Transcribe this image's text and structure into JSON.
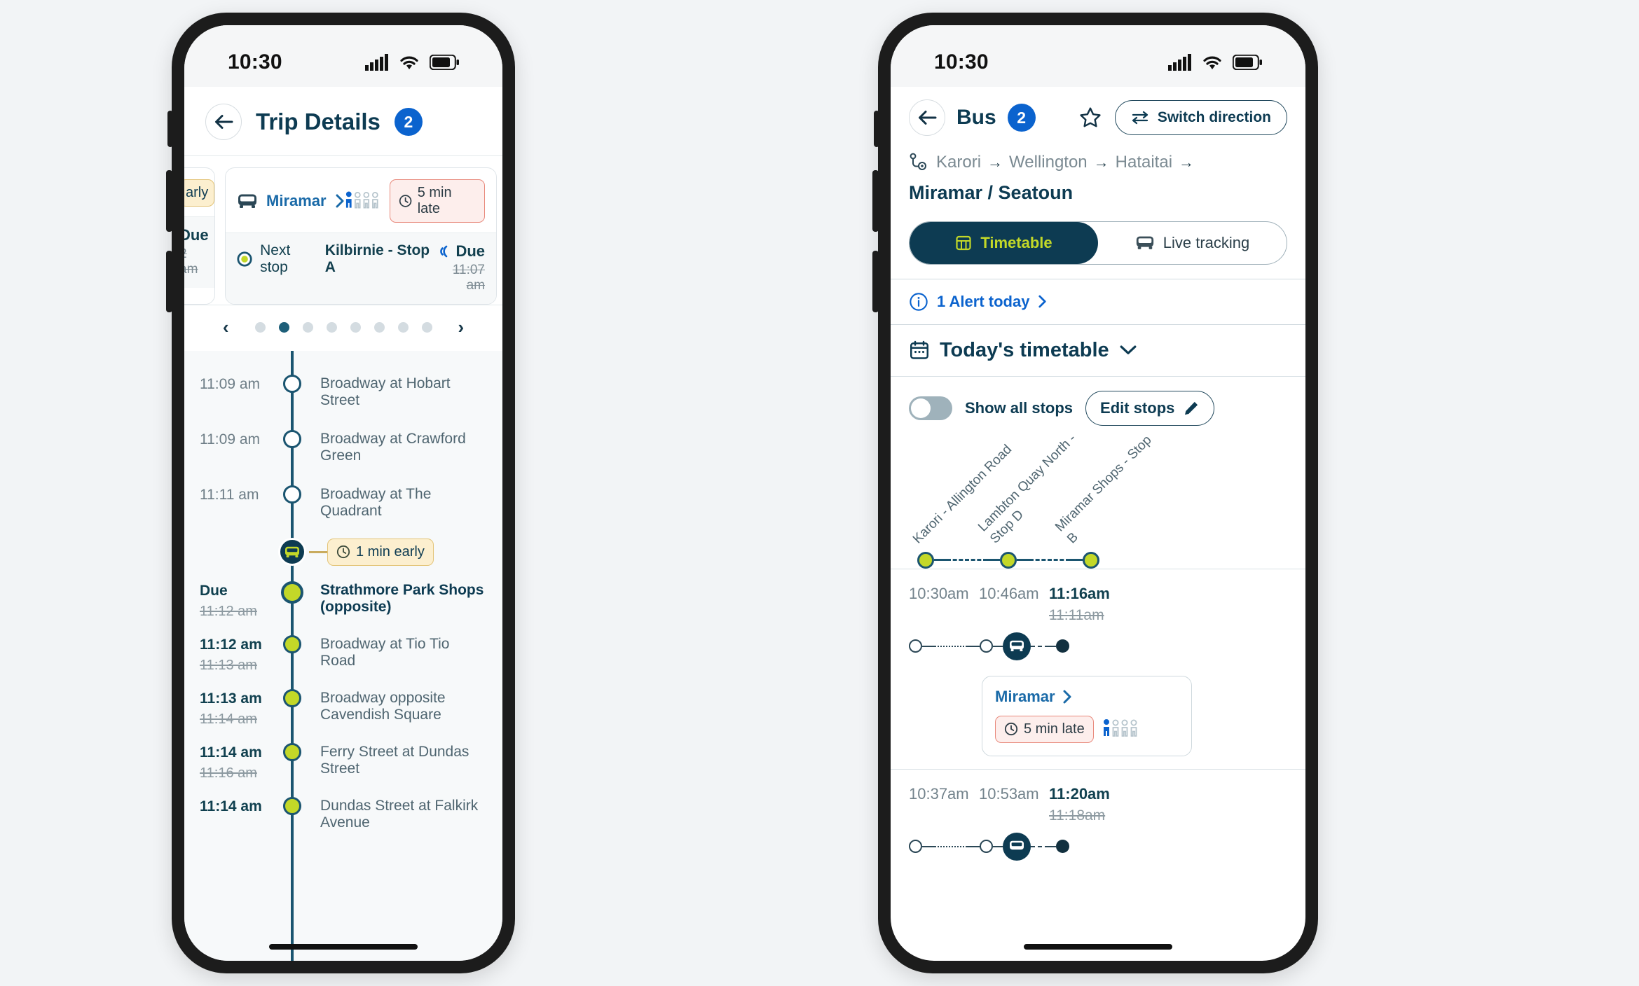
{
  "left_phone": {
    "status_bar": {
      "time": "10:30",
      "signal_icon": "cellular-signal-icon",
      "wifi_icon": "wifi-icon",
      "battery_icon": "battery-icon"
    },
    "header": {
      "back_icon": "back-arrow-icon",
      "title": "Trip Details",
      "badge": "2"
    },
    "partial_card": {
      "pill": "arly",
      "due_label": "Due",
      "due_strike": "2 am"
    },
    "trip_card": {
      "bus_icon": "bus-icon",
      "route_name": "Miramar",
      "chevron_icon": "chevron-right-icon",
      "occupancy_icon": "occupancy-people-icon",
      "status_icon": "clock-icon",
      "status_label": "5 min late",
      "next_stop_prefix": "Next stop",
      "next_stop_name": "Kilbirnie - Stop A",
      "realtime_icon": "live-signal-icon",
      "due_label": "Due",
      "due_strike": "11:07 am"
    },
    "pagination": {
      "prev_icon": "chevron-left-icon",
      "next_icon": "chevron-right-icon",
      "total": 8,
      "active_index": 1
    },
    "timeline": {
      "bus_marker": {
        "icon": "bus-icon",
        "status_icon": "clock-icon",
        "status_label": "1 min early"
      },
      "stops": [
        {
          "time": "11:09 am",
          "scheduled": "",
          "name": "Broadway at Hobart Street",
          "state": "past",
          "emphasis": false
        },
        {
          "time": "11:09 am",
          "scheduled": "",
          "name": "Broadway at Crawford Green",
          "state": "past",
          "emphasis": false
        },
        {
          "time": "11:11 am",
          "scheduled": "",
          "name": "Broadway at The Quadrant",
          "state": "past",
          "emphasis": false
        },
        {
          "time": "Due",
          "scheduled": "11:12 am",
          "name": "Strathmore Park Shops (opposite)",
          "state": "current",
          "emphasis": true
        },
        {
          "time": "11:12 am",
          "scheduled": "11:13 am",
          "name": "Broadway at Tio Tio Road",
          "state": "upcoming",
          "emphasis": false
        },
        {
          "time": "11:13 am",
          "scheduled": "11:14 am",
          "name": "Broadway opposite Cavendish Square",
          "state": "upcoming",
          "emphasis": false
        },
        {
          "time": "11:14 am",
          "scheduled": "11:16 am",
          "name": "Ferry Street at Dundas Street",
          "state": "upcoming",
          "emphasis": false
        },
        {
          "time": "11:14 am",
          "scheduled": "",
          "name": "Dundas Street at Falkirk Avenue",
          "state": "upcoming",
          "emphasis": false
        }
      ]
    }
  },
  "right_phone": {
    "status_bar": {
      "time": "10:30",
      "signal_icon": "cellular-signal-icon",
      "wifi_icon": "wifi-icon",
      "battery_icon": "battery-icon"
    },
    "header": {
      "back_icon": "back-arrow-icon",
      "mode_label": "Bus",
      "badge": "2",
      "favourite_icon": "star-outline-icon",
      "switch_icon": "switch-direction-icon",
      "switch_label": "Switch direction"
    },
    "breadcrumb": {
      "route_icon": "route-pin-icon",
      "arrow": "→",
      "items": [
        "Karori",
        "Wellington",
        "Hataitai"
      ],
      "current": "Miramar / Seatoun"
    },
    "tabs": [
      {
        "label": "Timetable",
        "icon": "timetable-grid-icon",
        "active": true
      },
      {
        "label": "Live tracking",
        "icon": "bus-icon",
        "active": false
      }
    ],
    "alert": {
      "icon": "info-circle-icon",
      "label": "1 Alert today",
      "chevron_icon": "chevron-right-icon"
    },
    "today": {
      "icon": "calendar-icon",
      "label": "Today's timetable",
      "chevron_icon": "chevron-down-icon"
    },
    "controls": {
      "toggle_label": "Show all stops",
      "toggle_on": false,
      "edit_label": "Edit stops",
      "edit_icon": "pencil-icon"
    },
    "stop_headers": [
      "Karori - Allington Road",
      "Lambton Quay North - \nStop D",
      "Miramar Shops - Stop \nB"
    ],
    "trips": [
      {
        "times": [
          "10:30am",
          "10:46am",
          "11:16am"
        ],
        "bold_index": 2,
        "scheduled": "11:11am",
        "card": {
          "route_name": "Miramar",
          "chevron_icon": "chevron-right-icon",
          "status_icon": "clock-icon",
          "status_label": "5 min late",
          "occupancy_icon": "occupancy-people-icon"
        }
      },
      {
        "times": [
          "10:37am",
          "10:53am",
          "11:20am"
        ],
        "bold_index": 2,
        "scheduled": "11:18am",
        "card": null
      }
    ]
  }
}
